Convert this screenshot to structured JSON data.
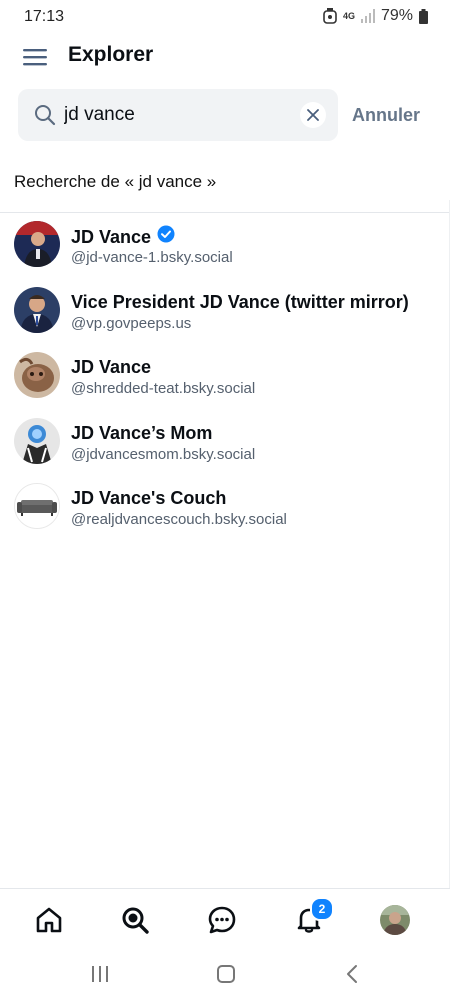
{
  "status_bar": {
    "time": "17:13",
    "network": "4G",
    "battery": "79%"
  },
  "header": {
    "title": "Explorer"
  },
  "search": {
    "value": "jd vance",
    "cancel_label": "Annuler",
    "results_label": "Recherche de « jd vance »"
  },
  "results": [
    {
      "name": "JD Vance",
      "handle": "@jd-vance-1.bsky.social",
      "verified": true
    },
    {
      "name": "Vice President JD Vance (twitter mirror)",
      "handle": "@vp.govpeeps.us",
      "verified": false
    },
    {
      "name": "JD Vance",
      "handle": "@shredded-teat.bsky.social",
      "verified": false
    },
    {
      "name": "JD Vance’s Mom",
      "handle": "@jdvancesmom.bsky.social",
      "verified": false
    },
    {
      "name": "JD Vance's Couch",
      "handle": "@realjdvancescouch.bsky.social",
      "verified": false
    }
  ],
  "bottom_nav": {
    "notifications_badge": "2",
    "items": [
      "home-icon",
      "search-icon",
      "chat-icon",
      "bell-icon",
      "profile-avatar"
    ]
  },
  "colors": {
    "accent": "#1083fe",
    "muted_text": "#55606e",
    "cancel_text": "#66768a",
    "search_bg": "#f1f3f5"
  }
}
